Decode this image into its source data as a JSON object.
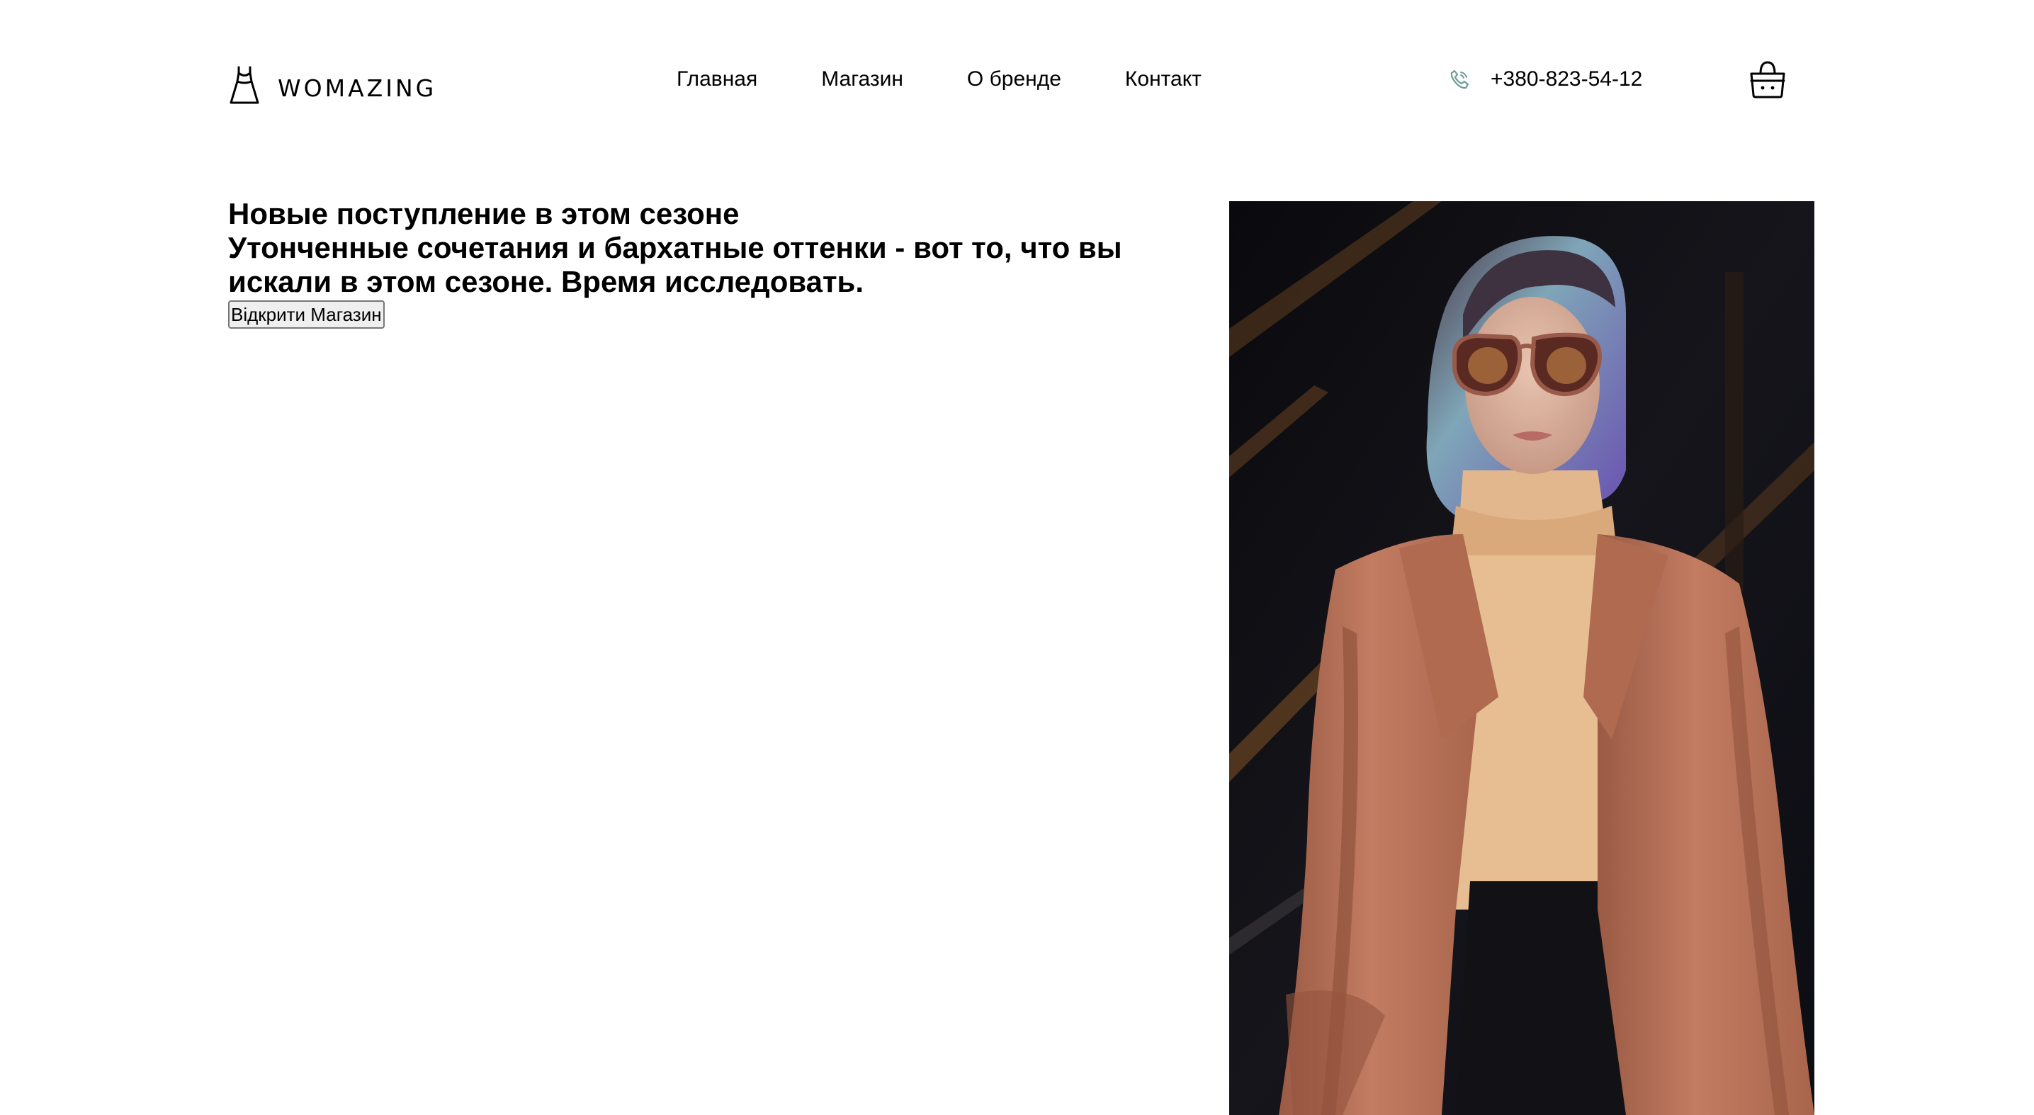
{
  "header": {
    "logo_text": "WOMAZING",
    "logo_icon": "dress-icon",
    "nav": [
      {
        "label": "Главная"
      },
      {
        "label": "Магазин"
      },
      {
        "label": "О бренде"
      },
      {
        "label": "Контакт"
      }
    ],
    "phone_icon": "phone-icon",
    "phone": "+380-823-54-12",
    "cart_icon": "shopping-basket-icon"
  },
  "hero": {
    "title": "Новые поступление в этом сезоне",
    "subtitle": "Утонченные сочетания и бархатные оттенки - вот то, что вы искали в этом сезоне. Время исследовать.",
    "button_label": "Відкрити Магазин",
    "image_description_icon": "woman-in-coat-photo"
  },
  "colors": {
    "background": "#ffffff",
    "text": "#000000",
    "phone_icon": "#6e9e95",
    "coat": "#b8725a",
    "photo_bg": "#141418"
  }
}
